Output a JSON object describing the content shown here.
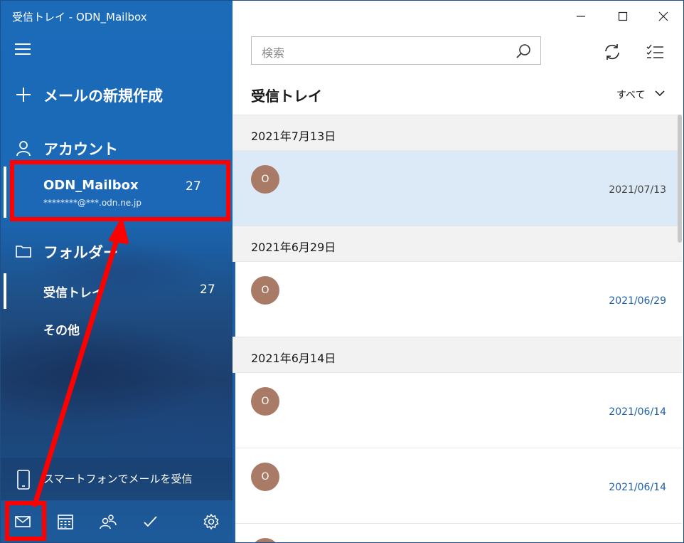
{
  "window": {
    "title": "受信トレイ - ODN_Mailbox"
  },
  "sidebar": {
    "new_mail_label": "メールの新規作成",
    "accounts_label": "アカウント",
    "account": {
      "name": "ODN_Mailbox",
      "email": "********@***.odn.ne.jp",
      "unread_count": "27"
    },
    "folders_label": "フォルダー",
    "folders": [
      {
        "label": "受信トレイ",
        "count": "27"
      },
      {
        "label": "その他",
        "count": ""
      }
    ],
    "phone_label": "スマートフォンでメールを受信",
    "bottom_icons": [
      "mail-icon",
      "calendar-icon",
      "people-icon",
      "todo-icon",
      "settings-icon"
    ]
  },
  "toolbar": {
    "search_placeholder": "検索",
    "inbox_title": "受信トレイ",
    "filter_label": "すべて"
  },
  "messages": {
    "groups": [
      {
        "date_header": "2021年7月13日",
        "items": [
          {
            "avatar": "O",
            "date": "2021/07/13",
            "selected": true,
            "unread": false
          }
        ]
      },
      {
        "date_header": "2021年6月29日",
        "items": [
          {
            "avatar": "O",
            "date": "2021/06/29",
            "selected": false,
            "unread": true
          }
        ]
      },
      {
        "date_header": "2021年6月14日",
        "items": [
          {
            "avatar": "O",
            "date": "2021/06/14",
            "selected": false,
            "unread": true
          },
          {
            "avatar": "O",
            "date": "2021/06/14",
            "selected": false,
            "unread": true
          }
        ]
      }
    ]
  },
  "colors": {
    "accent": "#1e5fa8",
    "annotation": "#ff0000",
    "avatar": "#a97a66",
    "selection": "#dceaf7"
  }
}
